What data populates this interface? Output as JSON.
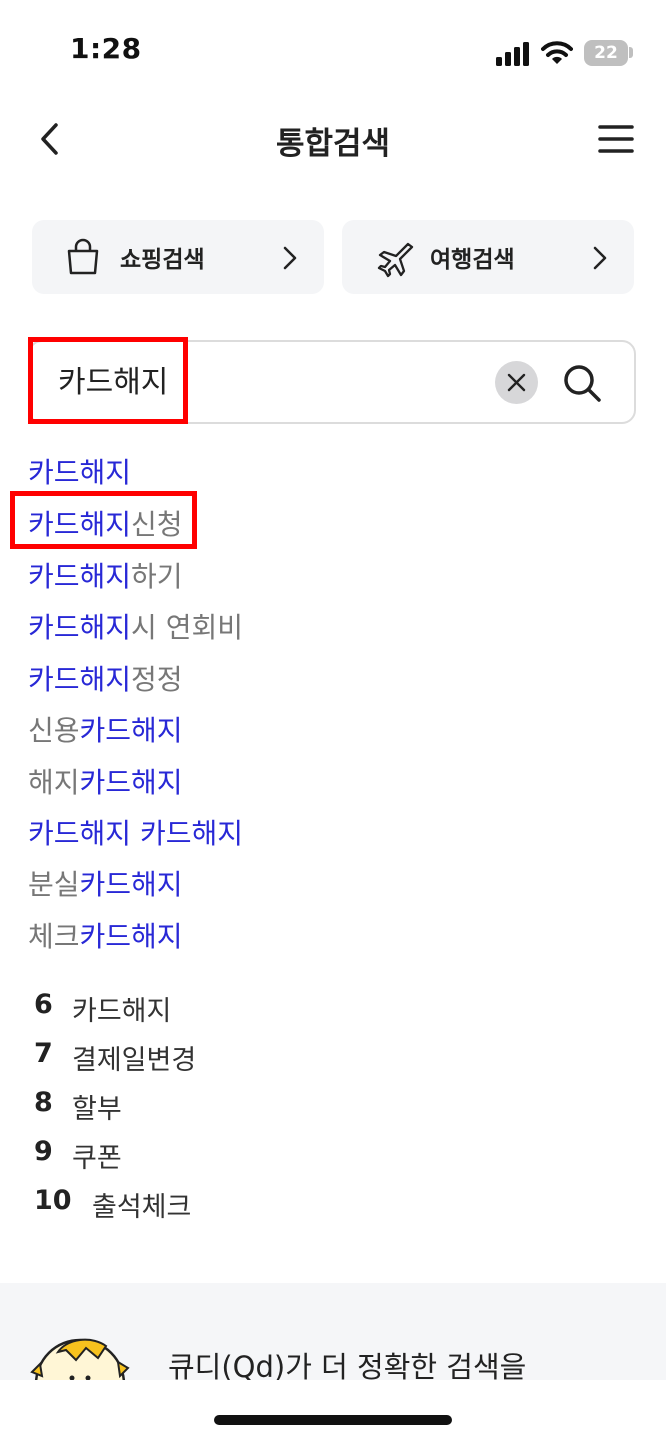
{
  "status_bar": {
    "time": "1:28",
    "battery": "22"
  },
  "header": {
    "title": "통합검색"
  },
  "quick_buttons": [
    {
      "label": "쇼핑검색",
      "icon": "shopping-bag-icon"
    },
    {
      "label": "여행검색",
      "icon": "airplane-icon"
    }
  ],
  "search": {
    "value": "카드해지"
  },
  "suggestions": [
    {
      "prefix": "",
      "highlight": "카드해지",
      "suffix": ""
    },
    {
      "prefix": "",
      "highlight": "카드해지",
      "suffix": "신청"
    },
    {
      "prefix": "",
      "highlight": "카드해지",
      "suffix": "하기"
    },
    {
      "prefix": "",
      "highlight": "카드해지",
      "suffix": "시 연회비"
    },
    {
      "prefix": "",
      "highlight": "카드해지",
      "suffix": "정정"
    },
    {
      "prefix": "신용",
      "highlight": "카드해지",
      "suffix": ""
    },
    {
      "prefix": "해지",
      "highlight": "카드해지",
      "suffix": ""
    },
    {
      "prefix": "",
      "highlight": "카드해지 카드해지",
      "suffix": ""
    },
    {
      "prefix": "분실",
      "highlight": "카드해지",
      "suffix": ""
    },
    {
      "prefix": "체크",
      "highlight": "카드해지",
      "suffix": ""
    }
  ],
  "rankings": [
    {
      "num": "6",
      "text": "카드해지"
    },
    {
      "num": "7",
      "text": "결제일변경"
    },
    {
      "num": "8",
      "text": "할부"
    },
    {
      "num": "9",
      "text": "쿠폰"
    },
    {
      "num": "10",
      "text": "출석체크"
    }
  ],
  "promo": {
    "text": "큐디(Qd)가 더 정확한 검색을"
  },
  "colors": {
    "highlight": "#2828d6",
    "annotation": "#ff0000",
    "panel": "#f4f5f7"
  }
}
